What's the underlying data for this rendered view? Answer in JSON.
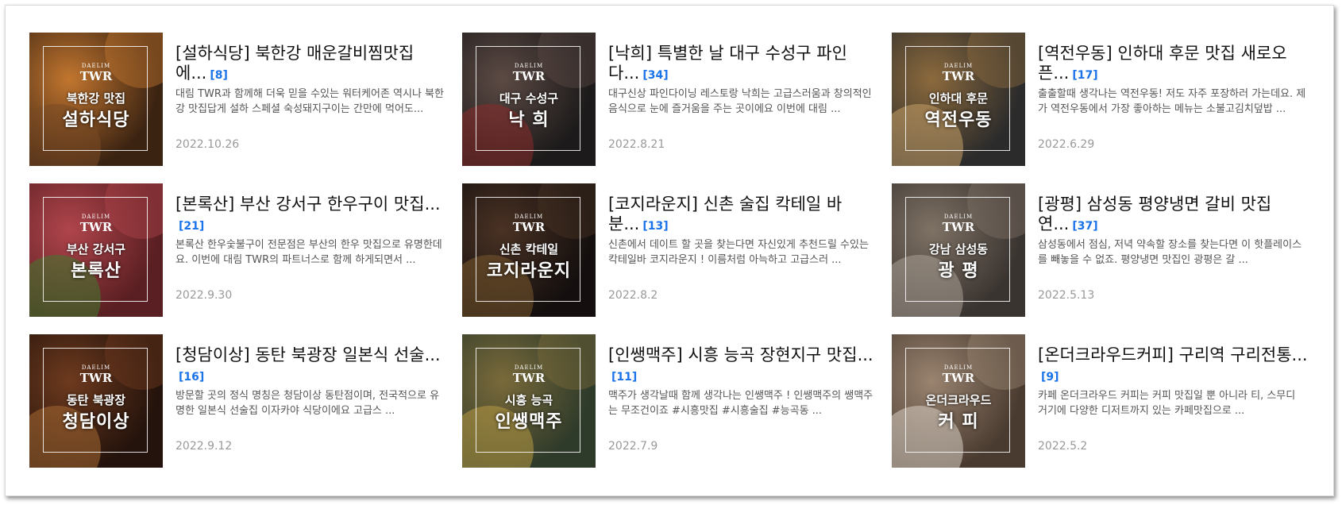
{
  "thumb_brand_small": "DAELIM",
  "thumb_brand": "TWR",
  "posts": [
    {
      "title": "[설하식당] 북한강 매운갈비찜맛집 에...",
      "count": "[8]",
      "desc": "대림 TWR과 함께해 더욱 믿을 수있는  워터케어존 역시나 북한강 맛집답게 설하 스페셜 숙성돼지구이는 간만에 먹어도...",
      "date": "2022.10.26",
      "thumb_sub": "북한강 맛집",
      "thumb_main": "설하식당",
      "colors": [
        "#3b2312",
        "#c2762f",
        "#7a4a24"
      ]
    },
    {
      "title": "[낙희] 특별한 날 대구 수성구 파인다...",
      "count": "[34]",
      "desc": "대구신상 파인다이닝 레스토랑  낙희는 고급스러움과 창의적인 음식으로 눈에 즐거움을 주는 곳이에요 이번에 대림 ...",
      "date": "2022.8.21",
      "thumb_sub": "대구 수성구",
      "thumb_main": "낙 희",
      "colors": [
        "#1c1a1a",
        "#5c4a44",
        "#8a2b2b"
      ]
    },
    {
      "title": "[역전우동] 인하대 후문 맛집 새로오픈...",
      "count": "[17]",
      "desc": "출출할때 생각나는 역전우동! 저도 자주 포장하러 가는데요. 제가 역전우동에서 가장 좋아하는 메뉴는 소불고김치덮밥 ...",
      "date": "2022.6.29",
      "thumb_sub": "인하대 후문",
      "thumb_main": "역전우동",
      "colors": [
        "#2b2b2b",
        "#8c6a3d",
        "#c7a067"
      ]
    },
    {
      "title": "[본록산] 부산 강서구 한우구이 맛집...",
      "count": "[21]",
      "desc": "본록산 한우숯불구이 전문점은 부산의 한우 맛집으로 유명한데요. 이번에 대림 TWR의 파트너스로 함께 하게되면서 ...",
      "date": "2022.9.30",
      "thumb_sub": "부산 강서구",
      "thumb_main": "본록산",
      "colors": [
        "#5a1f22",
        "#b0454c",
        "#3f7a2f"
      ]
    },
    {
      "title": "[코지라운지] 신촌 술집 칵테일 바 분...",
      "count": "[13]",
      "desc": "신촌에서 데이트 할 곳을 찾는다면 자신있게 추천드릴 수있는 칵테일바 코지라운지 ! 이름처럼 아늑하고 고급스러 ...",
      "date": "2022.8.2",
      "thumb_sub": "신촌 칵테일",
      "thumb_main": "코지라운지",
      "colors": [
        "#140f0e",
        "#4a3224",
        "#7a5a2e"
      ]
    },
    {
      "title": "[광평] 삼성동 평양냉면 갈비 맛집 연...",
      "count": "[37]",
      "desc": "삼성동에서 점심, 저녁 약속할 장소를 찾는다면 이 핫플레이스를 빼놓을 수 없죠. 평양냉면 맛집인 광평은 갈 ...",
      "date": "2022.5.13",
      "thumb_sub": "강남 삼성동",
      "thumb_main": "광 평",
      "colors": [
        "#3a3430",
        "#7f7265",
        "#a9a095"
      ]
    },
    {
      "title": "[청담이상] 동탄 북광장 일본식 선술...",
      "count": "[16]",
      "desc": "방문할 곳의 정식 명칭은 청담이상 동탄점이며, 전국적으로 유명한 일본식 선술집 이자카야 식당이에요 고급스 ...",
      "date": "2022.9.12",
      "thumb_sub": "동탄 북광장",
      "thumb_main": "청담이상",
      "colors": [
        "#24130c",
        "#6e3a1e",
        "#a66a33"
      ]
    },
    {
      "title": "[인쌩맥주] 시흥 능곡 장현지구 맛집...",
      "count": "[11]",
      "desc": "맥주가 생각날때 함께 생각나는 인쌩맥주 ! 인쌩맥주의 쌩맥주는 무조건이죠 #시흥맛집 #시흥술집 #능곡동 ...",
      "date": "2022.7.9",
      "thumb_sub": "시흥 능곡",
      "thumb_main": "인쌩맥주",
      "colors": [
        "#2e3a2a",
        "#7a6a3a",
        "#b89a44"
      ]
    },
    {
      "title": "[온더크라우드커피] 구리역 구리전통...",
      "count": "[9]",
      "desc": "카페 온더크라우드 커피는 커피 맛집일 뿐 아니라 티, 스무디 거기에 다양한 디저트까지 있는 카페맛집으로 ...",
      "date": "2022.5.2",
      "thumb_sub": "온더크라우드",
      "thumb_main": "커 피",
      "colors": [
        "#4a3b30",
        "#9a8470",
        "#d8cfc4"
      ]
    }
  ]
}
